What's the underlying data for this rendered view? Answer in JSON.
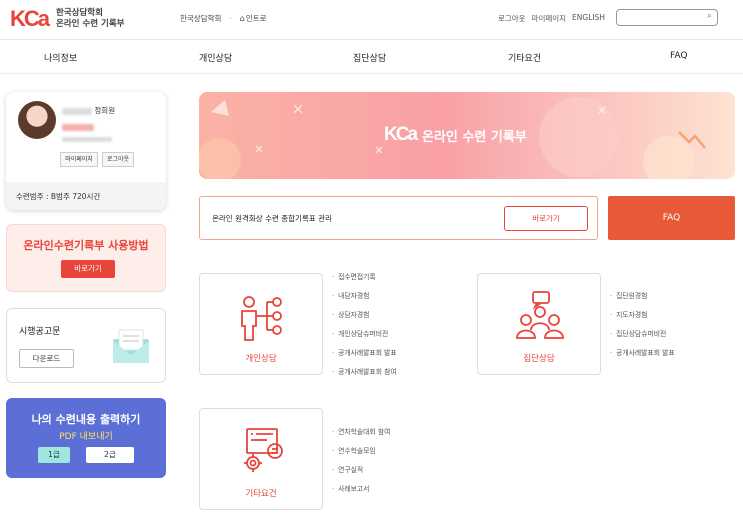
{
  "header": {
    "logo_mark": "KCa",
    "logo_line1": "한국상담학회",
    "logo_line2": "온라인 수련 기록부",
    "site_link": "한국상담학회",
    "separator": "·",
    "intro_link": "인트로",
    "logout": "로그아웃",
    "mypage": "마이페이지",
    "english": "ENGLISH",
    "search_placeholder": ""
  },
  "nav": {
    "items": [
      "나의정보",
      "개인상담",
      "집단상담",
      "기타요건",
      "FAQ"
    ]
  },
  "profile": {
    "member_type": "정회원",
    "btn_mypage": "마이페이지",
    "btn_logout": "로그아웃",
    "category": "수련범주 : B범주 720시간"
  },
  "guide": {
    "title": "온라인수련기록부 사용방법",
    "button": "바로가기"
  },
  "notice": {
    "title": "시행공고문",
    "button": "다운로드"
  },
  "print": {
    "title": "나의 수련내용 출력하기",
    "subtitle": "PDF 내보내기",
    "grade1": "1급",
    "grade2": "2급"
  },
  "banner": {
    "mark": "KCa",
    "title": "온라인 수련 기록부"
  },
  "remote": {
    "text": "온라인 원격화상 수련 종합기록표 관리",
    "button": "바로가기"
  },
  "faq_box": "FAQ",
  "categories": {
    "individual": {
      "label": "개인상담",
      "items": [
        "접수면접기록",
        "내담자경험",
        "상담자경험",
        "개인상담슈퍼비전",
        "공개사례발표회 발표",
        "공개사례발표회 참여"
      ]
    },
    "group": {
      "label": "집단상담",
      "items": [
        "집단원경험",
        "지도자경험",
        "집단상담슈퍼비전",
        "공개사례발표회 발표"
      ]
    },
    "other": {
      "label": "기타요건",
      "items": [
        "연차학술대회 참여",
        "연수학술모임",
        "연구실적",
        "사례보고서"
      ]
    }
  },
  "colors": {
    "brand": "#e8443a",
    "faq": "#e85a37",
    "print_card": "#5b6fd6",
    "print_sub": "#ffe35a"
  }
}
